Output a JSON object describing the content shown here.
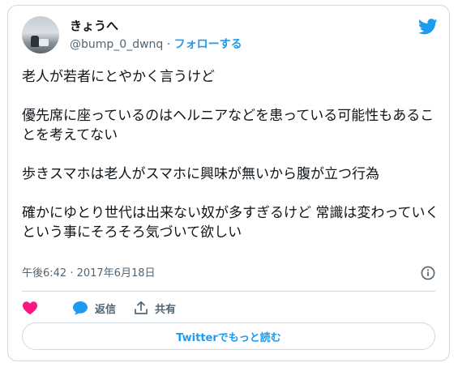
{
  "author": {
    "display_name": "きょうへ",
    "handle": "@bump_0_dwnq",
    "separator": "·",
    "follow_label": "フォローする"
  },
  "tweet": {
    "paragraphs": [
      "老人が若者にとやかく言うけど",
      "優先席に座っているのはヘルニアなどを患っている可能性もあることを考えてない",
      "歩きスマホは老人がスマホに興味が無いから腹が立つ行為",
      "確かにゆとり世代は出来ない奴が多すぎるけど 常識は変わっていくという事にそろそろ気づいて欲しい"
    ],
    "timestamp": "午後6:42 · 2017年6月18日"
  },
  "actions": {
    "reply_label": "返信",
    "share_label": "共有"
  },
  "read_more_label": "Twitterでもっと読む",
  "icons": {
    "brand": "twitter-bird-icon",
    "like": "heart-icon",
    "reply": "speech-bubble-icon",
    "share": "share-icon",
    "info": "info-icon"
  },
  "colors": {
    "accent": "#1d9bf0",
    "like": "#f91880",
    "text": "#0f1419",
    "muted": "#536471",
    "border": "#cfd9de"
  }
}
